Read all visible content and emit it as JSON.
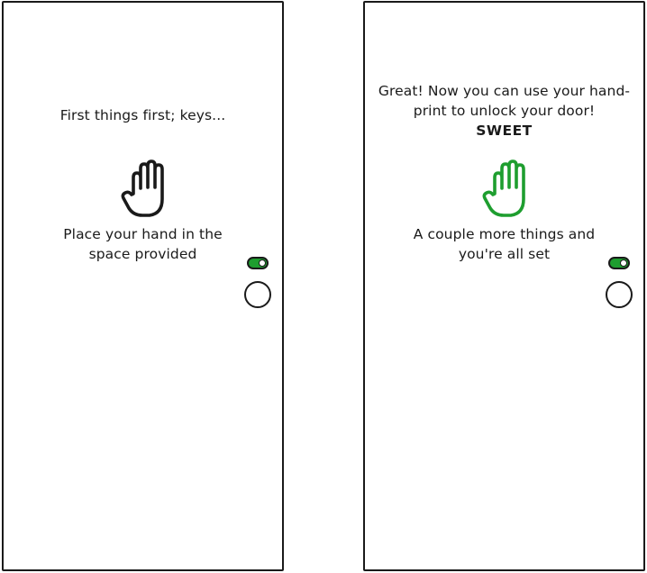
{
  "colors": {
    "outline": "#1a1a1a",
    "accent_green": "#1e9e2f",
    "background": "#ffffff"
  },
  "screens": [
    {
      "heading": "First things first; keys...",
      "hand_icon": "raised-hand-icon",
      "hand_color": "#1a1a1a",
      "subtitle_line1": "Place your hand in the",
      "subtitle_line2": "space provided",
      "toggle_on": true
    },
    {
      "heading_line1": "Great! Now you can use your hand-",
      "heading_line2": "print to unlock your door!",
      "strong_word": "SWEET",
      "hand_icon": "raised-hand-icon",
      "hand_color": "#1e9e2f",
      "subtitle_line1": "A couple more things and",
      "subtitle_line2": "you're all set",
      "toggle_on": true
    }
  ]
}
